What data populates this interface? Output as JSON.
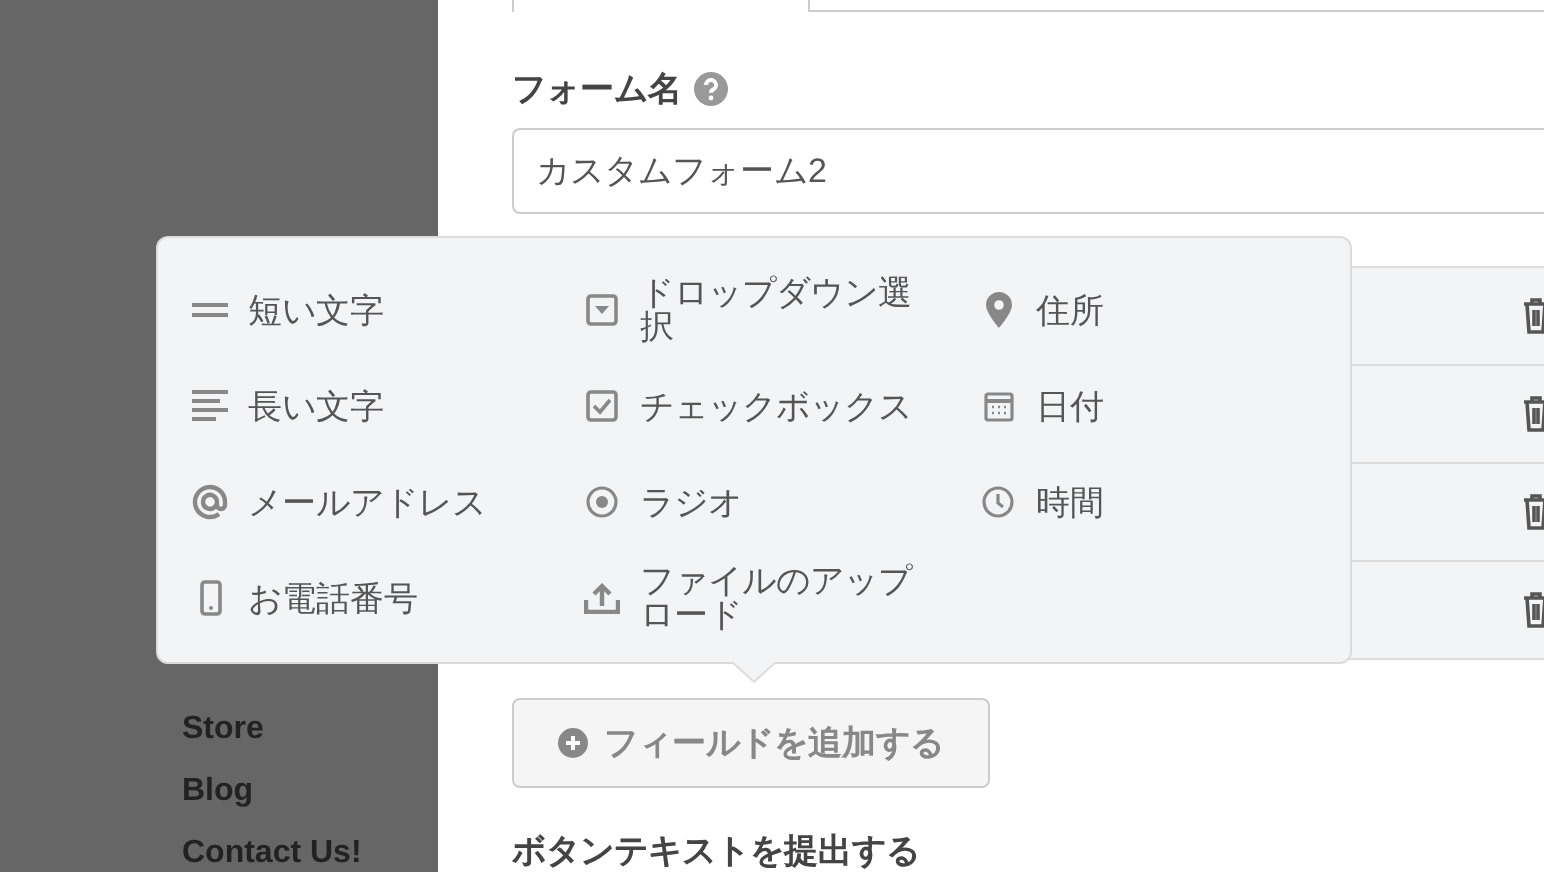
{
  "sidebar": {
    "items": [
      {
        "label": "Store"
      },
      {
        "label": "Blog"
      },
      {
        "label": "Contact Us!"
      }
    ]
  },
  "form": {
    "name_label": "フォーム名",
    "name_value": "カスタムフォーム2",
    "add_button": "フィールドを追加する",
    "submit_label": "ボタンテキストを提出する"
  },
  "field_menu": {
    "items": [
      {
        "label": "短い文字",
        "kind": "short"
      },
      {
        "label": "ドロップダウン選択",
        "kind": "dropdown"
      },
      {
        "label": "住所",
        "kind": "address"
      },
      {
        "label": "長い文字",
        "kind": "long"
      },
      {
        "label": "チェックボックス",
        "kind": "checkbox"
      },
      {
        "label": "日付",
        "kind": "date"
      },
      {
        "label": "メールアドレス",
        "kind": "email"
      },
      {
        "label": "ラジオ",
        "kind": "radio"
      },
      {
        "label": "時間",
        "kind": "time"
      },
      {
        "label": "お電話番号",
        "kind": "phone"
      },
      {
        "label": "ファイルのアップロード",
        "kind": "upload"
      }
    ]
  }
}
